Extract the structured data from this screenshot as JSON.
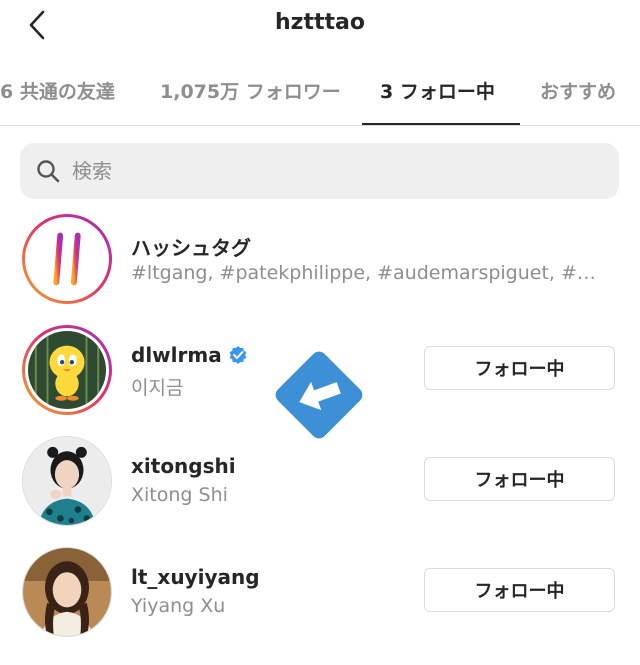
{
  "header": {
    "title": "hztttao",
    "back_icon": "chevron-left-icon"
  },
  "tabs": [
    {
      "label": "6 共通の友達",
      "active": false
    },
    {
      "label": "1,075万 フォロワー",
      "active": false
    },
    {
      "label": "3 フォロー中",
      "active": true
    },
    {
      "label": "おすすめ",
      "active": false
    }
  ],
  "search": {
    "placeholder": "検索",
    "value": "",
    "icon": "search-icon"
  },
  "hashtag_row": {
    "title": "ハッシュタグ",
    "subtitle": "#ltgang, #patekphilippe, #audemarspiguet, #…",
    "icon": "hashtag-icon"
  },
  "following": [
    {
      "username": "dlwlrma",
      "full_name": "이지금",
      "verified": true,
      "button_label": "フォロー中"
    },
    {
      "username": "xitongshi",
      "full_name": "Xitong Shi",
      "verified": false,
      "button_label": "フォロー中"
    },
    {
      "username": "lt_xuyiyang",
      "full_name": "Yiyang Xu",
      "verified": false,
      "button_label": "フォロー中"
    }
  ],
  "colors": {
    "accent_blue": "#3d8fd6",
    "verified_blue": "#3897f0",
    "ring_gradient": [
      "#f9a825",
      "#e1306c",
      "#a02fbf"
    ],
    "muted_text": "#8e8e8e"
  }
}
